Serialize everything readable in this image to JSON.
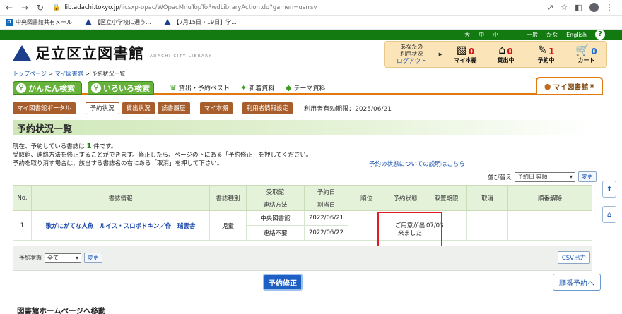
{
  "browser": {
    "url_host": "lib.adachi.tokyo.jp",
    "url_path": "/licsxp-opac/WOpacMnuTopToPwdLibraryAction.do?gamen=usrrsv",
    "bookmarks": [
      {
        "label": "中央図書館共有メール",
        "icon": "outlook-icon"
      },
      {
        "label": "【区立小学校に通う...",
        "icon": "triangle-icon"
      },
      {
        "label": "【7月15日・19日】学...",
        "icon": "triangle-icon"
      }
    ]
  },
  "topbar": {
    "font_sizes": [
      "大",
      "中",
      "小"
    ],
    "modes": [
      "一般",
      "かな",
      "English"
    ],
    "help": "?"
  },
  "header": {
    "logo_title": "足立区立図書館",
    "logo_sub": "ADACHI CITY LIBRARY",
    "user_line1": "あなたの",
    "user_line2": "利用状況",
    "logout": "ログアウト",
    "stats": [
      {
        "label": "マイ本棚",
        "count": "0",
        "icon": "bookshelf-icon"
      },
      {
        "label": "貸出中",
        "count": "0",
        "icon": "house-icon"
      },
      {
        "label": "予約中",
        "count": "1",
        "icon": "reservation-icon"
      },
      {
        "label": "カート",
        "count": "0",
        "icon": "cart-icon"
      }
    ]
  },
  "breadcrumb": {
    "top": "トップページ",
    "mylib": "マイ図書館",
    "current": "予約状況一覧",
    "sep": ">"
  },
  "tabs": {
    "easy": "かんたん検索",
    "advanced": "いろいろ検索",
    "best": "貸出・予約ベスト",
    "new": "新着資料",
    "theme": "テーマ資料",
    "mylib": "マイ図書館"
  },
  "subnav": {
    "items": [
      "マイ図書館ポータル",
      "予約状況",
      "貸出状況",
      "読書履歴",
      "マイ本棚",
      "利用者情報設定"
    ],
    "valid_until": "利用者有効期限：2025/06/21"
  },
  "page": {
    "title": "予約状況一覧",
    "intro_pre": "現在、予約している書誌は ",
    "intro_count": "1",
    "intro_post": " 件です。",
    "intro_line2": "受取館、連絡方法を修正することができます。修正したら、ページの下にある「予約修正」を押してください。",
    "intro_line3": "予約を取り消す場合は、該当する書誌名の右にある「取消」を押して下さい。",
    "help_link": "予約の状態についての説明はこちら",
    "sort_label": "並び替え",
    "sort_value": "予約日 昇順",
    "change": "変更"
  },
  "table": {
    "headers": {
      "no": "No.",
      "info": "書誌情報",
      "type": "書誌種別",
      "pickup": "受取館",
      "contact": "連絡方法",
      "reserve_date": "予約日",
      "assign_date": "割当日",
      "rank": "順位",
      "status": "予約状態",
      "deadline": "取置期限",
      "cancel": "取消",
      "cancel_order": "順番解除"
    },
    "rows": [
      {
        "no": "1",
        "title": "歌がにがてな人魚　ルイス・スロボドキン／作　瑞雲舎",
        "type": "児童",
        "pickup": "中央図書館",
        "contact": "連絡不要",
        "reserve_date": "2022/06/21",
        "assign_date": "2022/06/22",
        "rank": "",
        "status_line1": "ご用意が出",
        "status_line2": "来ました",
        "deadline": "07/03",
        "cancel": "",
        "cancel_order": ""
      }
    ]
  },
  "filter": {
    "label": "予約状態",
    "value": "全て",
    "change": "変更",
    "csv": "CSV出力"
  },
  "actions": {
    "submit": "予約修正",
    "queue": "順番予約へ"
  },
  "footer": {
    "heading": "図書館ホームページへ移動"
  }
}
